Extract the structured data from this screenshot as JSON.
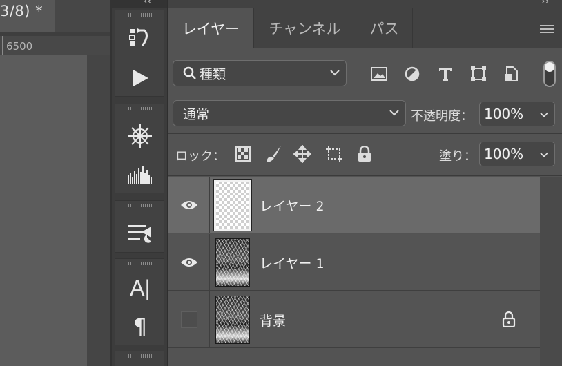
{
  "document": {
    "tab_title": "3/8) *",
    "ruler_label": "6500"
  },
  "dock": {
    "collapse_left": "‹‹",
    "collapse_right": "››",
    "text_tool_label": "A|",
    "paragraph_label": "¶"
  },
  "layers_panel": {
    "tabs": [
      {
        "label": "レイヤー"
      },
      {
        "label": "チャンネル"
      },
      {
        "label": "パス"
      }
    ],
    "filter": {
      "kind_label": "種類"
    },
    "blend_mode": "通常",
    "opacity_label": "不透明度：",
    "opacity_value": "100%",
    "lock_label": "ロック：",
    "fill_label": "塗り：",
    "fill_value": "100%",
    "layers": [
      {
        "name": "レイヤー 2",
        "visible": true,
        "selected": true,
        "locked": false
      },
      {
        "name": "レイヤー 1",
        "visible": true,
        "selected": false,
        "locked": false
      },
      {
        "name": "背景",
        "visible": false,
        "selected": false,
        "locked": true
      }
    ]
  }
}
